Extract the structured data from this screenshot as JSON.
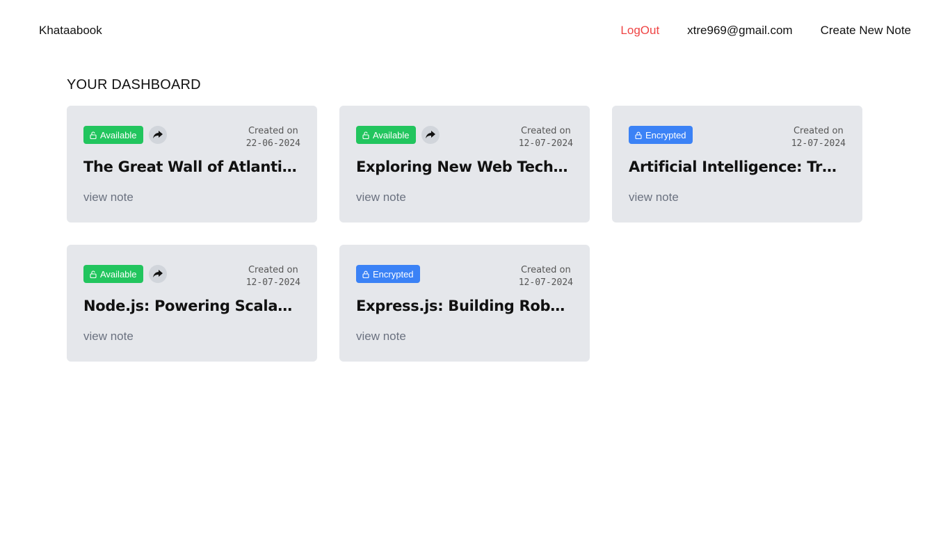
{
  "nav": {
    "brand": "Khataabook",
    "logout": "LogOut",
    "email": "xtre969@gmail.com",
    "create": "Create New Note"
  },
  "dashboard": {
    "title": "YOUR DASHBOARD"
  },
  "colors": {
    "available": "#22c55e",
    "encrypted": "#3b82f6",
    "logout": "#ef4444",
    "card_bg": "#e5e7eb"
  },
  "notes": [
    {
      "status": "Available",
      "created_label": "Created on",
      "date": "22-06-2024",
      "title": "The Great Wall of Atlantis: Un…",
      "link": "view note"
    },
    {
      "status": "Available",
      "created_label": "Created on",
      "date": "12-07-2024",
      "title": "Exploring New Web Technolo…",
      "link": "view note"
    },
    {
      "status": "Encrypted",
      "created_label": "Created on",
      "date": "12-07-2024",
      "title": "Artificial Intelligence: Transfo…",
      "link": "view note"
    },
    {
      "status": "Available",
      "created_label": "Created on",
      "date": "12-07-2024",
      "title": "Node.js: Powering Scalable a…",
      "link": "view note"
    },
    {
      "status": "Encrypted",
      "created_label": "Created on",
      "date": "12-07-2024",
      "title": "Express.js: Building Robust W…",
      "link": "view note"
    }
  ]
}
